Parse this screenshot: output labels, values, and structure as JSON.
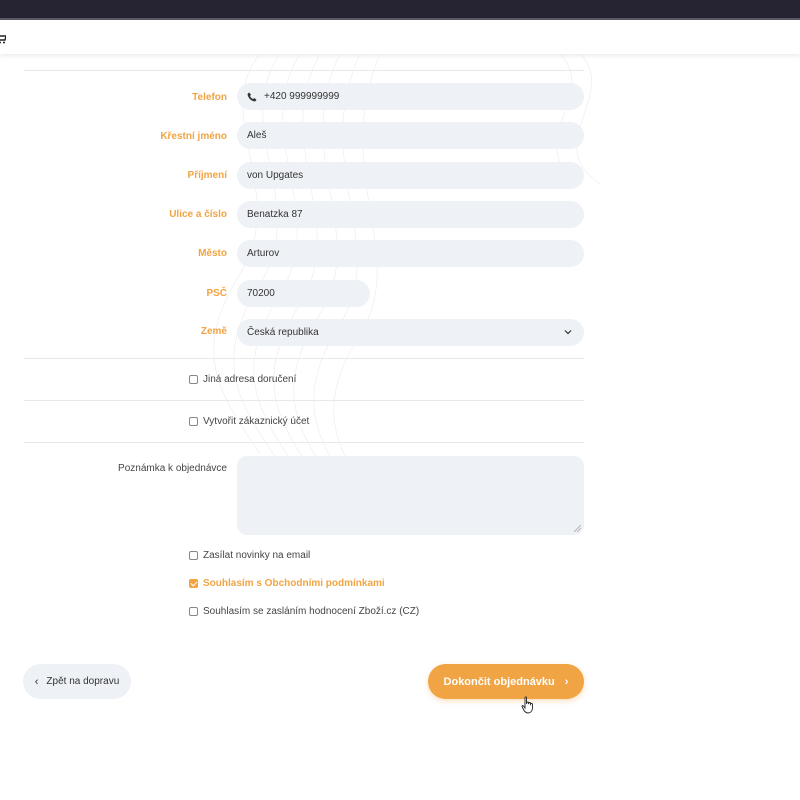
{
  "form": {
    "phone": {
      "label": "Telefon",
      "value": "+420 999999999"
    },
    "first_name": {
      "label": "Křestní jméno",
      "value": "Aleš"
    },
    "last_name": {
      "label": "Příjmení",
      "value": "von Upgates"
    },
    "street": {
      "label": "Ulice a číslo",
      "value": "Benatzka 87"
    },
    "city": {
      "label": "Město",
      "value": "Arturov"
    },
    "zip": {
      "label": "PSČ",
      "value": "70200"
    },
    "country": {
      "label": "Země",
      "value": "Česká republika"
    }
  },
  "options": {
    "other_delivery": "Jiná adresa doručení",
    "create_account": "Vytvořit zákaznický účet"
  },
  "note": {
    "label": "Poznámka k objednávce"
  },
  "consents": [
    {
      "label": "Zasílat novinky na email",
      "checked": false
    },
    {
      "label": "Souhlasím s Obchodními podmínkami",
      "checked": true
    },
    {
      "label": "Souhlasím se zasláním hodnocení Zboží.cz (CZ)",
      "checked": false
    }
  ],
  "buttons": {
    "back": "Zpět na dopravu",
    "finish": "Dokončit objednávku"
  },
  "colors": {
    "accent": "#f0a443",
    "field_bg": "#eef1f5",
    "topbar": "#262432"
  },
  "icons": [
    "cart-icon",
    "phone-icon",
    "chevron-down-icon",
    "chevron-left-icon",
    "chevron-right-icon",
    "hand-cursor-icon"
  ]
}
